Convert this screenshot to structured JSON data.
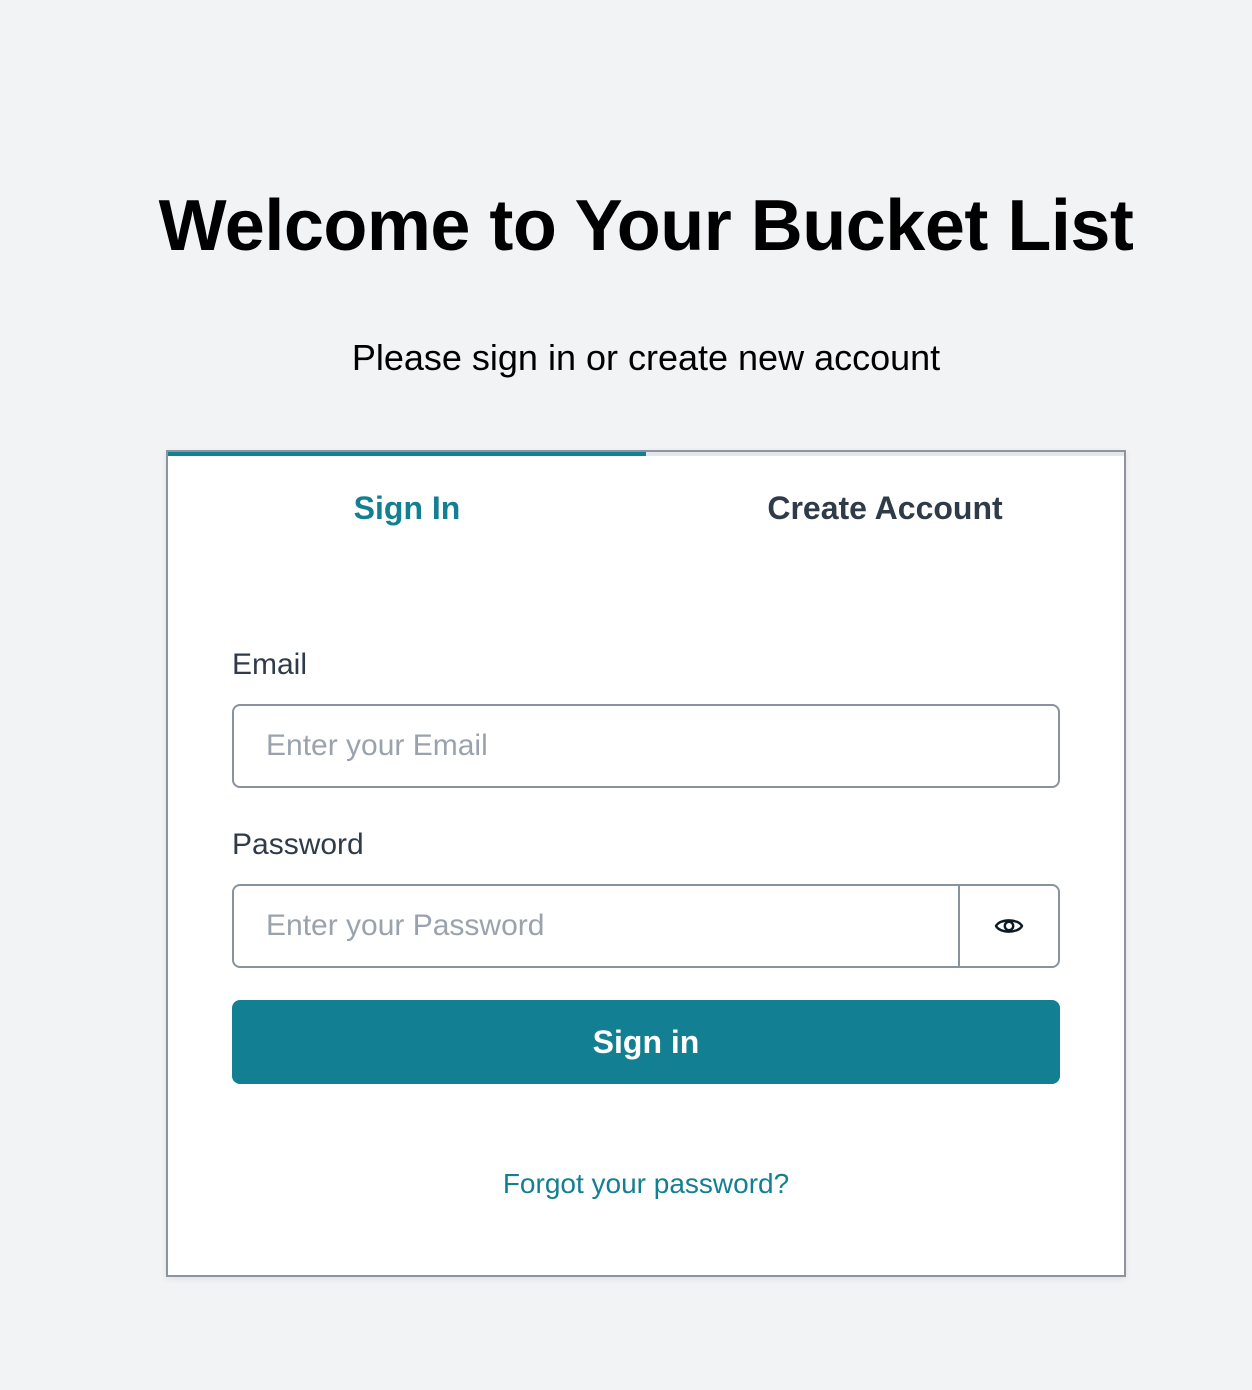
{
  "header": {
    "title": "Welcome to Your Bucket List",
    "subtitle": "Please sign in or create new account"
  },
  "tabs": [
    {
      "label": "Sign In",
      "active": true
    },
    {
      "label": "Create Account",
      "active": false
    }
  ],
  "form": {
    "email_label": "Email",
    "email_placeholder": "Enter your Email",
    "email_value": "",
    "password_label": "Password",
    "password_placeholder": "Enter your Password",
    "password_value": "",
    "show_password_icon": "eye-icon",
    "submit_label": "Sign in",
    "forgot_label": "Forgot your password?"
  },
  "colors": {
    "accent": "#137f92",
    "background": "#f2f3f5",
    "card": "#ffffff",
    "border": "#89939e"
  }
}
